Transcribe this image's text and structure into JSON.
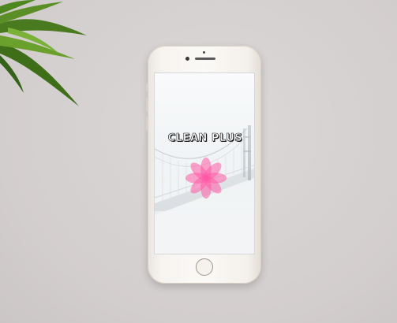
{
  "app": {
    "title": "CLEAN PLUS"
  },
  "icons": {
    "logo": "pink-lotus-flower-icon",
    "home": "home-button",
    "plant": "plant-leaves-decoration"
  },
  "colors": {
    "background": "#d6d1d1",
    "phone_body": "#f7f4f0",
    "logo_pink": "#ff5aa5",
    "title_text": "#ffffff"
  }
}
